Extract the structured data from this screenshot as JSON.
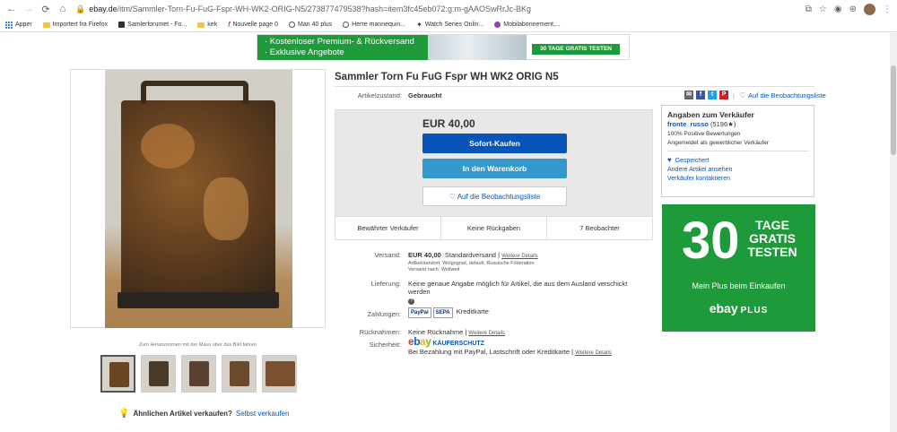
{
  "browser": {
    "url_host": "ebay.de",
    "url_path": "/itm/Sammler-Torn-Fu-FuG-Fspr-WH-WK2-ORIG-N5/273877479538?hash=item3fc45eb072:g:m-gAAOSwRrJc-BKg"
  },
  "bookmarks": [
    {
      "label": "Apper"
    },
    {
      "label": "Importert fra Firefox"
    },
    {
      "label": "Samlerforumet - Fo..."
    },
    {
      "label": "kek"
    },
    {
      "label": "Nouvelle page 0"
    },
    {
      "label": "Man 40 plus"
    },
    {
      "label": "Herre mannequin..."
    },
    {
      "label": "Watch Series Onlin..."
    },
    {
      "label": "Mobilabonnement,..."
    }
  ],
  "banner": {
    "line1": "· Kostenloser Premium- & Rückversand",
    "line2": "· Exklusive Angebote",
    "cta": "30 TAGE GRATIS TESTEN"
  },
  "gallery": {
    "zoom_hint": "Zum Heranzoomen mit der Maus über das Bild fahren"
  },
  "sell": {
    "question": "Ähnlichen Artikel verkaufen?",
    "link": "Selbst verkaufen"
  },
  "item": {
    "title": "Sammler Torn Fu FuG Fspr WH WK2 ORIG N5",
    "condition_label": "Artikelzustand:",
    "condition_value": "Gebraucht",
    "watchlist_link": "Auf die Beobachtungsliste"
  },
  "buybox": {
    "price": "EUR 40,00",
    "buy_now": "Sofort-Kaufen",
    "add_to_cart": "In den Warenkorb",
    "watch": "Auf die Beobachtungsliste",
    "stats": [
      "Bewährter Verkäufer",
      "Keine Rückgaben",
      "7 Beobachter"
    ]
  },
  "details": {
    "shipping_label": "Versand:",
    "shipping_price": "EUR 40,00",
    "shipping_type": "Standardversand",
    "more_details": "Weitere Details",
    "item_location": "Artikelstandort:  Wolgograd, default, Russische Föderation",
    "ships_to": "Versand nach:  Weltweit",
    "delivery_label": "Lieferung:",
    "delivery_text": "Keine genaue Angabe möglich für Artikel, die aus dem Ausland verschickt werden",
    "payment_label": "Zahlungen:",
    "payment_paypal": "PayPal",
    "payment_sepa": "SEPA",
    "payment_card": "Kreditkarte",
    "returns_label": "Rücknahmen:",
    "returns_text": "Keine Rücknahme",
    "security_label": "Sicherheit:",
    "protection_label": "KÄUFERSCHUTZ",
    "protection_text": "Bei Bezahlung mit PayPal, Lastschrift oder Kreditkarte"
  },
  "seller": {
    "heading": "Angaben zum Verkäufer",
    "name": "fronte_russo",
    "feedback": "(5196",
    "positive": "100% Positive Bewertungen",
    "registered": "Angemeldet als gewerblicher Verkäufer",
    "saved": "Gespeichert",
    "other_items": "Andere Artikel ansehen",
    "contact": "Verkäufer kontaktieren"
  },
  "ad": {
    "number": "30",
    "tage": "TAGE",
    "gratis": "GRATIS",
    "testen": "TESTEN",
    "sub": "Mein Plus beim Einkaufen",
    "logo": "ebay",
    "logo_plus": "PLUS"
  },
  "colors": {
    "ebay_blue": "#0654ba",
    "cart_blue": "#3498ca",
    "ad_green": "#1f9a3b"
  }
}
